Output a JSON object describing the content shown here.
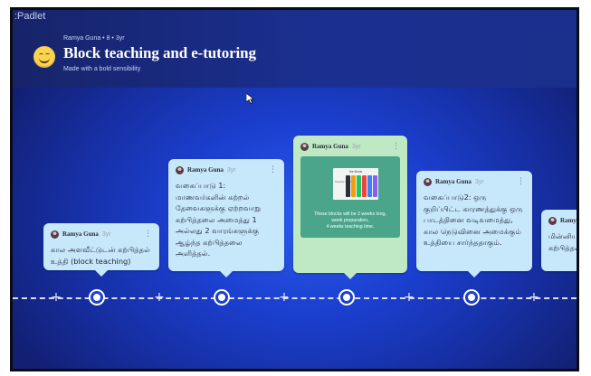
{
  "app": {
    "name": ":Padlet"
  },
  "header": {
    "meta": "Ramya Guna • 8 • 3yr",
    "title": "Block teaching and e-tutoring",
    "subtitle": "Made with a bold sensibility"
  },
  "colors": {
    "background": "#1b3fcf",
    "post_blue": "#c7e7fb",
    "post_green": "#bfe8c4",
    "attachment": "#4aa58b"
  },
  "posts": [
    {
      "author": "Ramya Guna",
      "time": "3yr",
      "body": "கால அளவீட்டுடன் கற்பித்தல் உத்தி (block teaching)"
    },
    {
      "author": "Ramya Guna",
      "time": "3yr",
      "body": "வகைப்பாடு 1: மாணவர்களின் கற்றல் தேவைகளுக்கு ஏற்றவாறு கற்பித்தலை அமைத்து 1 அல்லது 2 வாரங்களுக்கு ஆழ்ந்த கற்பித்தலை அளித்தல்."
    },
    {
      "author": "Ramya Guna",
      "time": "3yr",
      "attachment": {
        "thumb_title": "the Block",
        "thumb_side": "Teacher Gold",
        "caption_line1": "These blocks will be 2 weeks long,",
        "caption_line2": "week preparation,",
        "caption_line3": "4 weeks teaching time.",
        "bar_colors": [
          "#2d2d3a",
          "#f59e0b",
          "#22c55e",
          "#ef4444",
          "#3b82f6",
          "#8b5cf6"
        ]
      }
    },
    {
      "author": "Ramya Guna",
      "time": "3yr",
      "body": "வகைப்பாடு2: ஒரு குறிப்பிட்ட காரணத்துக்கு ஒரு பாடத்தினை வடிவமைத்து, கால நெடுவினை அமைக்கும் உத்தியை சார்ந்ததாகும்."
    },
    {
      "author": "Ramya G",
      "body": "மின்னியல் தனிக்கவ கற்பித்தல்"
    }
  ]
}
